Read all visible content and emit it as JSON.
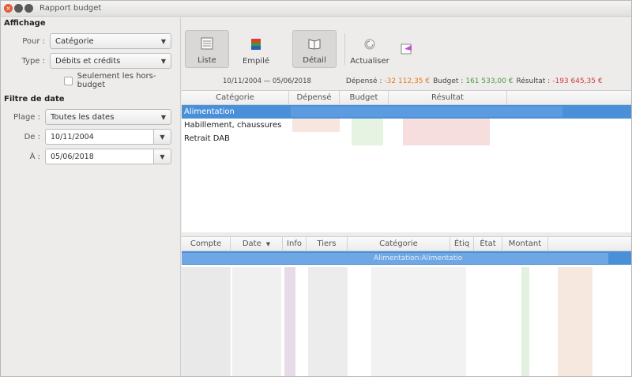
{
  "window": {
    "title": "Rapport budget"
  },
  "left": {
    "affichage_title": "Affichage",
    "pour": {
      "label": "Pour :",
      "value": "Catégorie"
    },
    "type": {
      "label": "Type :",
      "value": "Débits et crédits"
    },
    "hors_budget": {
      "label": "Seulement les hors-budget",
      "checked": false
    },
    "filtre_title": "Filtre de date",
    "plage": {
      "label": "Plage :",
      "value": "Toutes les dates"
    },
    "de": {
      "label": "De :",
      "value": "10/11/2004"
    },
    "a": {
      "label": "À :",
      "value": "05/06/2018"
    }
  },
  "toolbar": {
    "liste": "Liste",
    "empile": "Empilé",
    "detail": "Détail",
    "actualiser": "Actualiser",
    "icons": [
      "list-icon",
      "stacked-chart-icon",
      "detail-book-icon",
      "refresh-icon",
      "export-icon"
    ]
  },
  "summary": {
    "range": "10/11/2004 — 05/06/2018",
    "depense_label": "Dépensé :",
    "depense_value": "-32 112,35 €",
    "budget_label": "Budget :",
    "budget_value": "161 533,00 €",
    "resultat_label": "Résultat :",
    "resultat_value": "-193 645,35 €",
    "colors": {
      "depense": "#e07a1f",
      "budget": "#4a9a3a",
      "resultat": "#d03a3a"
    }
  },
  "budget_table": {
    "headers": [
      "Catégorie",
      "Dépensé",
      "Budget",
      "Résultat"
    ],
    "rows": [
      "Alimentation",
      "Habillement, chaussures",
      "Retrait DAB"
    ]
  },
  "detail_table": {
    "headers": [
      "Compte",
      "Date",
      "Info",
      "Tiers",
      "Catégorie",
      "Étiq",
      "État",
      "Montant"
    ],
    "selected_row": {
      "categorie": "Alimentation:Alimentatio"
    }
  },
  "colors": {
    "selection": "#4a90d9"
  }
}
